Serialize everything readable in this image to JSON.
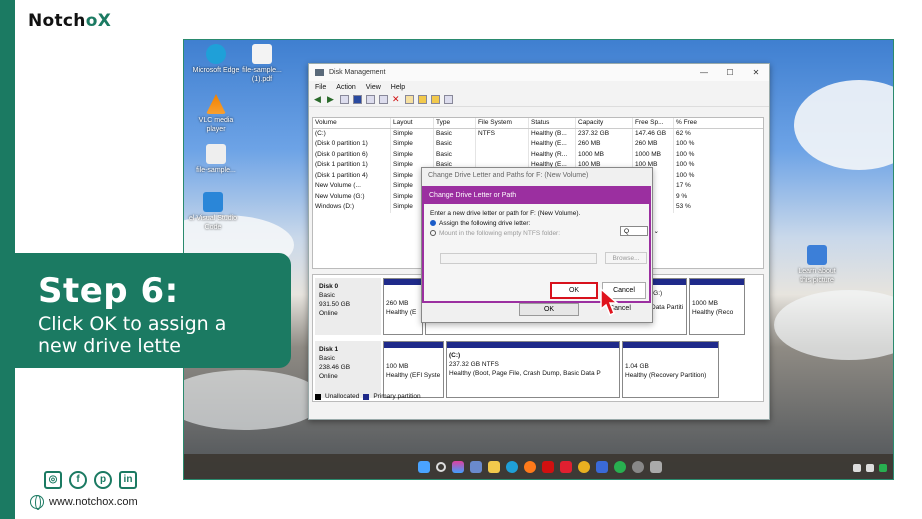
{
  "brand": {
    "pre": "Notch",
    "o": "o",
    "x": "X"
  },
  "step": {
    "heading": "Step 6:",
    "line1": "Click OK to assign a",
    "line2": "new drive lette"
  },
  "website": "www.notchox.com",
  "desktop": {
    "icons": [
      {
        "label": "Microsoft Edge"
      },
      {
        "label": "file-sample... (1).pdf"
      },
      {
        "label": "VLC media player"
      },
      {
        "label": "file-sample..."
      },
      {
        "label": "el Visual Studio Code"
      },
      {
        "label": "Learn about this picture"
      }
    ]
  },
  "window": {
    "title": "Disk Management",
    "menu": [
      "File",
      "Action",
      "View",
      "Help"
    ],
    "columns": [
      "Volume",
      "Layout",
      "Type",
      "File System",
      "Status",
      "Capacity",
      "Free Sp...",
      "% Free"
    ],
    "rows": [
      [
        "(C:)",
        "Simple",
        "Basic",
        "NTFS",
        "Healthy (B...",
        "237.32 GB",
        "147.46 GB",
        "62 %"
      ],
      [
        "(Disk 0 partition 1)",
        "Simple",
        "Basic",
        "",
        "Healthy (E...",
        "260 MB",
        "260 MB",
        "100 %"
      ],
      [
        "(Disk 0 partition 6)",
        "Simple",
        "Basic",
        "",
        "Healthy (R...",
        "1000 MB",
        "1000 MB",
        "100 %"
      ],
      [
        "(Disk 1 partition 1)",
        "Simple",
        "Basic",
        "",
        "Healthy (E...",
        "100 MB",
        "100 MB",
        "100 %"
      ],
      [
        "(Disk 1 partition 4)",
        "Simple",
        "Basic",
        "",
        "",
        "",
        "GB",
        "100 %"
      ],
      [
        "New Volume (...",
        "Simple",
        "Basic",
        "",
        "",
        "",
        "GB",
        "17 %"
      ],
      [
        "New Volume (G:)",
        "Simple",
        "Basic",
        "",
        "",
        "",
        "GB",
        "9 %"
      ],
      [
        "Windows (D:)",
        "Simple",
        "Basic",
        "",
        "",
        "",
        "GB",
        "53 %"
      ]
    ],
    "disk0": {
      "name": "Disk 0",
      "type": "Basic",
      "size": "931.50 GB",
      "status": "Online",
      "parts": [
        {
          "size": "260 MB",
          "status": "Healthy (E"
        },
        {
          "name": "(G:)",
          "status": "Data Partiti"
        },
        {
          "size": "1000 MB",
          "status": "Healthy (Reco"
        }
      ]
    },
    "disk1": {
      "name": "Disk 1",
      "type": "Basic",
      "size": "238.46 GB",
      "status": "Online",
      "parts": [
        {
          "size": "100 MB",
          "status": "Healthy (EFI Syste"
        },
        {
          "name": "(C:)",
          "size": "237.32 GB NTFS",
          "status": "Healthy (Boot, Page File, Crash Dump, Basic Data P"
        },
        {
          "size": "1.04 GB",
          "status": "Healthy (Recovery Partition)"
        }
      ]
    },
    "legend": {
      "unallocated": "Unallocated",
      "primary": "Primary partition"
    }
  },
  "dialog_back": {
    "title": "Change Drive Letter and Paths for F: (New Volume)",
    "ok": "OK",
    "cancel": "Cancel"
  },
  "dialog": {
    "title": "Change Drive Letter or Path",
    "prompt": "Enter a new drive letter or path for F: (New Volume).",
    "opt1": "Assign the following drive letter:",
    "letter": "Q",
    "opt2": "Mount in the following empty NTFS folder:",
    "browse": "Browse...",
    "ok": "OK",
    "cancel": "Cancel"
  },
  "colors": {
    "accent": "#1b7a62",
    "dialog_title": "#9b2fa0",
    "highlight": "#d8121d",
    "partition": "#1f2a8a"
  },
  "social": [
    "instagram-icon",
    "facebook-icon",
    "pinterest-icon",
    "linkedin-icon"
  ]
}
